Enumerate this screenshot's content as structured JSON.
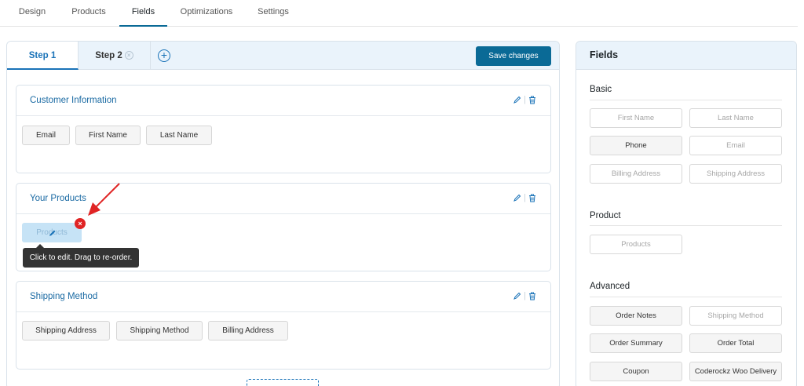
{
  "top_tabs": [
    "Design",
    "Products",
    "Fields",
    "Optimizations",
    "Settings"
  ],
  "steps": {
    "step1": "Step 1",
    "step2": "Step 2",
    "save_label": "Save changes"
  },
  "sections": [
    {
      "title": "Customer Information",
      "fields": [
        "Email",
        "First Name",
        "Last Name"
      ]
    },
    {
      "title": "Your Products",
      "fields": [
        "Products"
      ]
    },
    {
      "title": "Shipping Method",
      "fields": [
        "Shipping Address",
        "Shipping Method",
        "Billing Address"
      ]
    }
  ],
  "tooltip": "Click to edit. Drag to re-order.",
  "fields_panel": {
    "title": "Fields",
    "groups": [
      {
        "title": "Basic",
        "items": [
          "First Name",
          "Last Name",
          "Phone",
          "Email",
          "Billing Address",
          "Shipping Address"
        ]
      },
      {
        "title": "Product",
        "items": [
          "Products"
        ]
      },
      {
        "title": "Advanced",
        "items": [
          "Order Notes",
          "Shipping Method",
          "Order Summary",
          "Order Total",
          "Coupon",
          "Coderockz Woo Delivery"
        ]
      }
    ]
  },
  "colors": {
    "accent": "#0a6a96",
    "link": "#1a73b8",
    "remove": "#e02424"
  }
}
